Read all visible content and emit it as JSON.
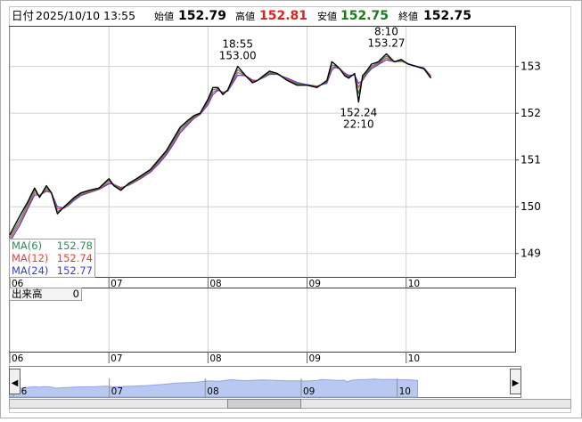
{
  "header": {
    "date_label": "日付",
    "datetime": "2025/10/10 13:55",
    "open_label": "始値",
    "open": "152.79",
    "high_label": "高値",
    "high": "152.81",
    "low_label": "安値",
    "low": "152.75",
    "close_label": "終値",
    "close": "152.75"
  },
  "colors": {
    "price": "#000000",
    "ma6": "#2e8b57",
    "ma12": "#e8403a",
    "ma24": "#3a3ae0",
    "high": "#e02020",
    "low": "#1a7a1a",
    "navigator_fill": "#b8c8f0",
    "navigator_line": "#8fa8e6"
  },
  "chart_data": {
    "type": "line",
    "title": "",
    "xlabel": "",
    "ylabel": "",
    "x_ticks": [
      "06",
      "07",
      "08",
      "09",
      "10"
    ],
    "y_ticks": [
      "149",
      "150",
      "151",
      "152",
      "153"
    ],
    "ylim": [
      148.5,
      153.85
    ],
    "x_range": [
      6.0,
      11.1
    ],
    "grid": true,
    "series": [
      {
        "key": "price",
        "x": [
          6.0,
          6.1,
          6.18,
          6.25,
          6.3,
          6.37,
          6.42,
          6.48,
          6.55,
          6.6,
          6.65,
          6.72,
          6.8,
          6.9,
          7.0,
          7.05,
          7.12,
          7.2,
          7.28,
          7.35,
          7.42,
          7.5,
          7.58,
          7.65,
          7.72,
          7.8,
          7.86,
          7.92,
          8.0,
          8.05,
          8.1,
          8.15,
          8.2,
          8.3,
          8.38,
          8.45,
          8.5,
          8.56,
          8.62,
          8.7,
          8.8,
          8.9,
          9.0,
          9.1,
          9.2,
          9.25,
          9.28,
          9.33,
          9.38,
          9.42,
          9.48,
          9.52,
          9.56,
          9.6,
          9.65,
          9.72,
          9.8,
          9.88,
          9.95,
          10.02,
          10.1,
          10.18,
          10.25
        ],
        "y": [
          149.4,
          149.8,
          150.1,
          150.4,
          150.2,
          150.45,
          150.3,
          149.85,
          150.0,
          150.1,
          150.2,
          150.3,
          150.35,
          150.4,
          150.6,
          150.45,
          150.35,
          150.5,
          150.6,
          150.7,
          150.8,
          151.0,
          151.2,
          151.45,
          151.7,
          151.85,
          151.95,
          152.0,
          152.3,
          152.55,
          152.55,
          152.4,
          152.5,
          153.0,
          152.8,
          152.65,
          152.7,
          152.8,
          152.9,
          152.85,
          152.7,
          152.6,
          152.6,
          152.55,
          152.7,
          153.1,
          153.05,
          152.95,
          152.8,
          152.75,
          152.85,
          152.24,
          152.8,
          152.9,
          153.05,
          153.1,
          153.27,
          153.1,
          153.15,
          153.05,
          153.0,
          152.95,
          152.75
        ]
      },
      {
        "key": "ma6",
        "name": "MA(6)",
        "x": [
          6.0,
          6.1,
          6.18,
          6.25,
          6.3,
          6.37,
          6.42,
          6.48,
          6.55,
          6.6,
          6.65,
          6.72,
          6.8,
          6.9,
          7.0,
          7.05,
          7.12,
          7.2,
          7.28,
          7.35,
          7.42,
          7.5,
          7.58,
          7.65,
          7.72,
          7.8,
          7.86,
          7.92,
          8.0,
          8.05,
          8.1,
          8.15,
          8.2,
          8.3,
          8.38,
          8.45,
          8.5,
          8.56,
          8.62,
          8.7,
          8.8,
          8.9,
          9.0,
          9.1,
          9.2,
          9.25,
          9.28,
          9.33,
          9.38,
          9.42,
          9.48,
          9.52,
          9.56,
          9.6,
          9.65,
          9.72,
          9.8,
          9.88,
          9.95,
          10.02,
          10.1,
          10.18,
          10.25
        ],
        "y": [
          149.35,
          149.72,
          150.05,
          150.35,
          150.22,
          150.4,
          150.3,
          149.9,
          149.98,
          150.08,
          150.18,
          150.28,
          150.33,
          150.39,
          150.56,
          150.47,
          150.37,
          150.48,
          150.58,
          150.68,
          150.78,
          150.97,
          151.17,
          151.41,
          151.66,
          151.82,
          151.93,
          151.99,
          152.26,
          152.5,
          152.53,
          152.42,
          152.49,
          152.93,
          152.8,
          152.67,
          152.7,
          152.78,
          152.87,
          152.84,
          152.71,
          152.62,
          152.6,
          152.56,
          152.68,
          153.03,
          153.02,
          152.95,
          152.82,
          152.77,
          152.83,
          152.42,
          152.75,
          152.87,
          153.01,
          153.08,
          153.22,
          153.1,
          153.13,
          153.05,
          153.0,
          152.95,
          152.77
        ]
      },
      {
        "key": "ma12",
        "name": "MA(12)",
        "x": [
          6.0,
          6.1,
          6.18,
          6.25,
          6.3,
          6.37,
          6.42,
          6.48,
          6.55,
          6.6,
          6.65,
          6.72,
          6.8,
          6.9,
          7.0,
          7.05,
          7.12,
          7.2,
          7.28,
          7.35,
          7.42,
          7.5,
          7.58,
          7.65,
          7.72,
          7.8,
          7.86,
          7.92,
          8.0,
          8.05,
          8.1,
          8.15,
          8.2,
          8.3,
          8.38,
          8.45,
          8.5,
          8.56,
          8.62,
          8.7,
          8.8,
          8.9,
          9.0,
          9.1,
          9.2,
          9.25,
          9.28,
          9.33,
          9.38,
          9.42,
          9.48,
          9.52,
          9.56,
          9.6,
          9.65,
          9.72,
          9.8,
          9.88,
          9.95,
          10.02,
          10.1,
          10.18,
          10.25
        ],
        "y": [
          149.3,
          149.66,
          150.0,
          150.3,
          150.24,
          150.36,
          150.3,
          149.95,
          149.97,
          150.06,
          150.16,
          150.26,
          150.31,
          150.38,
          150.52,
          150.48,
          150.39,
          150.47,
          150.56,
          150.66,
          150.76,
          150.94,
          151.14,
          151.37,
          151.62,
          151.79,
          151.91,
          151.98,
          152.22,
          152.45,
          152.51,
          152.44,
          152.48,
          152.87,
          152.8,
          152.69,
          152.7,
          152.77,
          152.85,
          152.84,
          152.73,
          152.64,
          152.6,
          152.57,
          152.66,
          152.97,
          153.0,
          152.95,
          152.84,
          152.79,
          152.82,
          152.55,
          152.72,
          152.85,
          152.98,
          153.06,
          153.18,
          153.1,
          153.12,
          153.05,
          153.0,
          152.96,
          152.79
        ]
      },
      {
        "key": "ma24",
        "name": "MA(24)",
        "x": [
          6.0,
          6.1,
          6.18,
          6.25,
          6.3,
          6.37,
          6.42,
          6.48,
          6.55,
          6.6,
          6.65,
          6.72,
          6.8,
          6.9,
          7.0,
          7.05,
          7.12,
          7.2,
          7.28,
          7.35,
          7.42,
          7.5,
          7.58,
          7.65,
          7.72,
          7.8,
          7.86,
          7.92,
          8.0,
          8.05,
          8.1,
          8.15,
          8.2,
          8.3,
          8.38,
          8.45,
          8.5,
          8.56,
          8.62,
          8.7,
          8.8,
          8.9,
          9.0,
          9.1,
          9.2,
          9.25,
          9.28,
          9.33,
          9.38,
          9.42,
          9.48,
          9.52,
          9.56,
          9.6,
          9.65,
          9.72,
          9.8,
          9.88,
          9.95,
          10.02,
          10.1,
          10.18,
          10.25
        ],
        "y": [
          149.25,
          149.6,
          149.95,
          150.25,
          150.25,
          150.33,
          150.3,
          150.0,
          149.97,
          150.04,
          150.14,
          150.24,
          150.3,
          150.37,
          150.49,
          150.48,
          150.41,
          150.46,
          150.55,
          150.64,
          150.74,
          150.91,
          151.11,
          151.33,
          151.58,
          151.76,
          151.89,
          151.97,
          152.18,
          152.4,
          152.49,
          152.45,
          152.47,
          152.81,
          152.8,
          152.71,
          152.7,
          152.76,
          152.83,
          152.83,
          152.75,
          152.66,
          152.61,
          152.58,
          152.64,
          152.92,
          152.98,
          152.95,
          152.86,
          152.81,
          152.82,
          152.64,
          152.7,
          152.83,
          152.95,
          153.04,
          153.14,
          153.1,
          153.11,
          153.06,
          153.01,
          152.97,
          152.8
        ]
      }
    ],
    "ma_legend": [
      {
        "key": "ma6",
        "label": "MA(6)",
        "value": "152.78"
      },
      {
        "key": "ma12",
        "label": "MA(12)",
        "value": "152.74"
      },
      {
        "key": "ma24",
        "label": "MA(24)",
        "value": "152.77"
      }
    ],
    "annotations": [
      {
        "x": 8.3,
        "y": 153.0,
        "lines": [
          "18:55",
          "153.00"
        ],
        "position": "above"
      },
      {
        "x": 9.8,
        "y": 153.27,
        "lines": [
          "8:10",
          "153.27"
        ],
        "position": "above"
      },
      {
        "x": 9.52,
        "y": 152.24,
        "lines": [
          "152.24",
          "22:10"
        ],
        "position": "below"
      }
    ],
    "volume_panel": {
      "label": "出来高",
      "value": "0",
      "x_ticks": [
        "06",
        "07",
        "08",
        "09",
        "10"
      ]
    },
    "navigator": {
      "x_ticks": [
        "06",
        "07",
        "08",
        "09",
        "10"
      ],
      "left_arrow": "◀",
      "right_arrow": "▶"
    }
  }
}
